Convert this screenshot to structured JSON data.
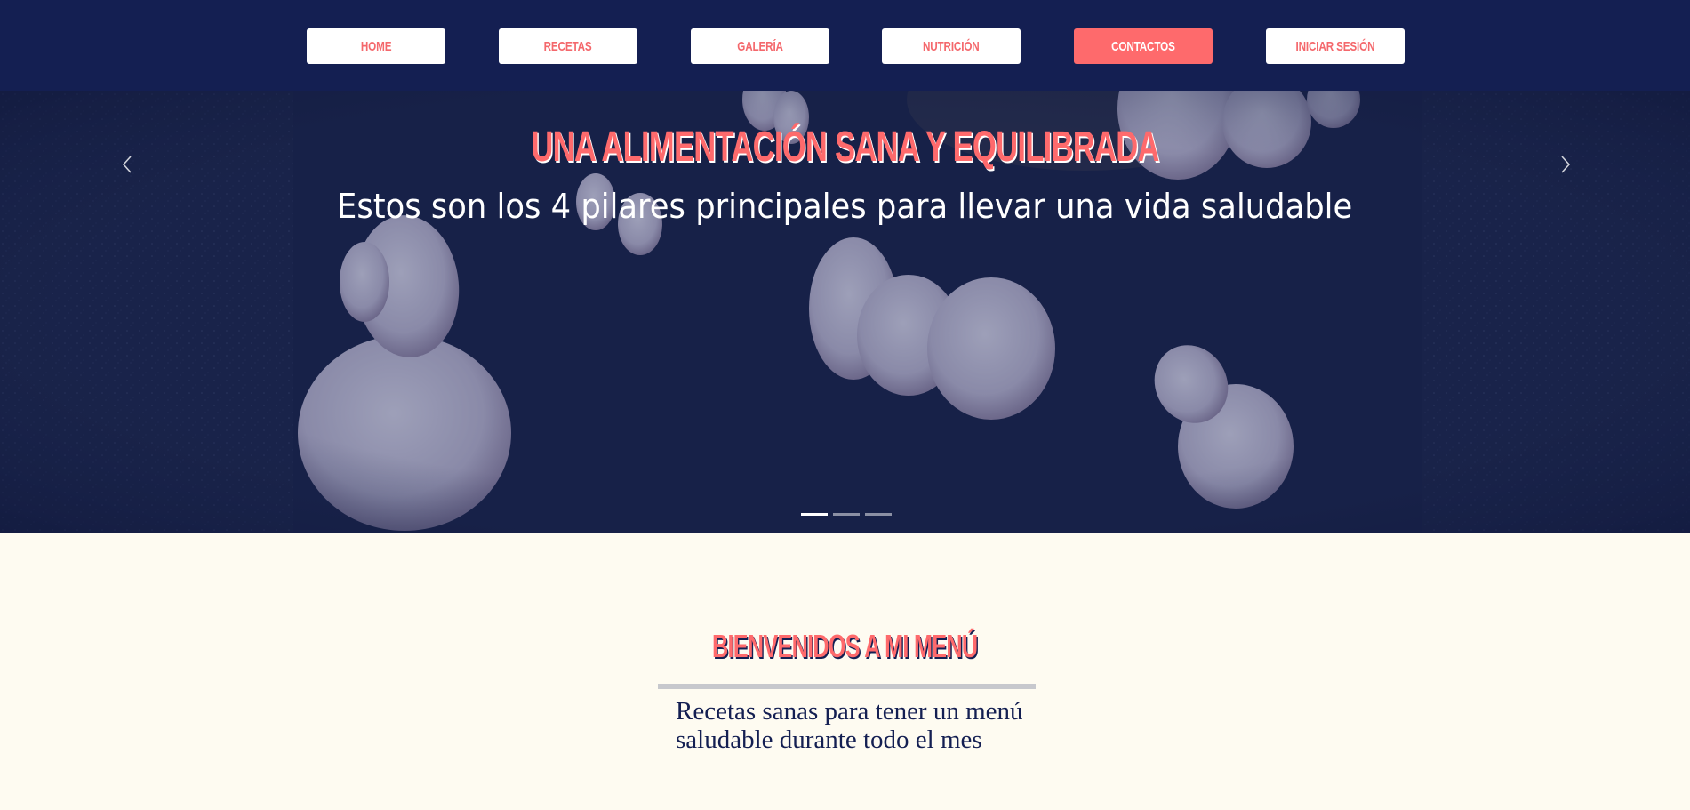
{
  "nav": {
    "items": [
      {
        "label": "HOME",
        "active": false
      },
      {
        "label": "RECETAS",
        "active": false
      },
      {
        "label": "GALERÍA",
        "active": false
      },
      {
        "label": "NUTRICIÓN",
        "active": false
      },
      {
        "label": "CONTACTOS",
        "active": true
      },
      {
        "label": "INICIAR SESIÓN",
        "active": false
      }
    ]
  },
  "hero": {
    "title": "UNA ALIMENTACIÓN SANA Y EQUILIBRADA",
    "subtitle": "Estos son los 4 pilares principales para llevar una vida saludable",
    "slide_count": 3,
    "active_slide": 1
  },
  "welcome": {
    "title": "BIENVENIDOS A MI MENÚ",
    "text_line1": "Recetas sanas para tener un menú",
    "text_line2": "saludable durante todo el mes"
  },
  "colors": {
    "nav_bg": "#141f52",
    "accent": "#fe6a6c",
    "page_bg": "#fefbf1",
    "text_dark": "#141f52"
  }
}
